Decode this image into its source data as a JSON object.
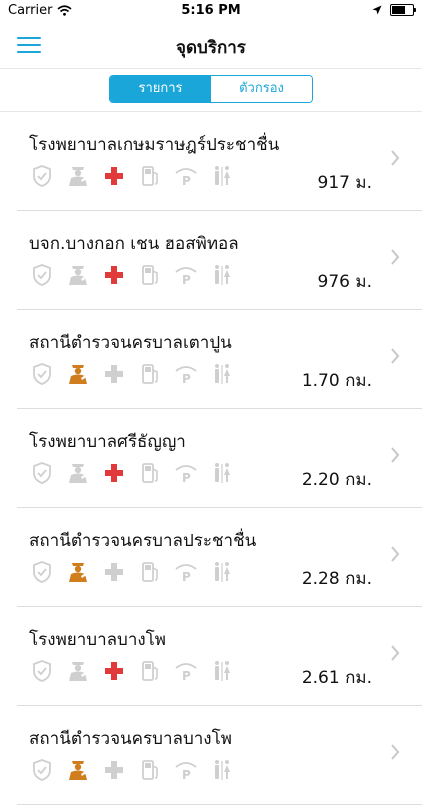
{
  "status_bar": {
    "carrier": "Carrier",
    "time": "5:16 PM"
  },
  "nav": {
    "title": "จุดบริการ"
  },
  "segment": {
    "list_label": "รายการ",
    "filter_label": "ตัวกรอง"
  },
  "colors": {
    "accent": "#1ba6d9",
    "red": "#e03a3a",
    "orange": "#d07d1d",
    "muted": "#cfcfcf"
  },
  "places": [
    {
      "name": "โรงพยาบาลเกษมราษฎร์ประชาชื่น",
      "distance": "917 ม.",
      "services": {
        "shield": false,
        "police": false,
        "medical": true,
        "fuel": false,
        "parking": false,
        "restroom": false
      }
    },
    {
      "name": "บจก.บางกอก เชน ฮอสพิทอล",
      "distance": "976 ม.",
      "services": {
        "shield": false,
        "police": false,
        "medical": true,
        "fuel": false,
        "parking": false,
        "restroom": false
      }
    },
    {
      "name": "สถานีตำรวจนครบาลเตาปูน",
      "distance": "1.70 กม.",
      "services": {
        "shield": false,
        "police": true,
        "medical": false,
        "fuel": false,
        "parking": false,
        "restroom": false
      }
    },
    {
      "name": "โรงพยาบาลศรีธัญญา",
      "distance": "2.20 กม.",
      "services": {
        "shield": false,
        "police": false,
        "medical": true,
        "fuel": false,
        "parking": false,
        "restroom": false
      }
    },
    {
      "name": "สถานีตำรวจนครบาลประชาชื่น",
      "distance": "2.28 กม.",
      "services": {
        "shield": false,
        "police": true,
        "medical": false,
        "fuel": false,
        "parking": false,
        "restroom": false
      }
    },
    {
      "name": "โรงพยาบาลบางโพ",
      "distance": "2.61 กม.",
      "services": {
        "shield": false,
        "police": false,
        "medical": true,
        "fuel": false,
        "parking": false,
        "restroom": false
      }
    },
    {
      "name": "สถานีตำรวจนครบาลบางโพ",
      "distance": "",
      "services": {
        "shield": false,
        "police": true,
        "medical": false,
        "fuel": false,
        "parking": false,
        "restroom": false
      }
    }
  ]
}
